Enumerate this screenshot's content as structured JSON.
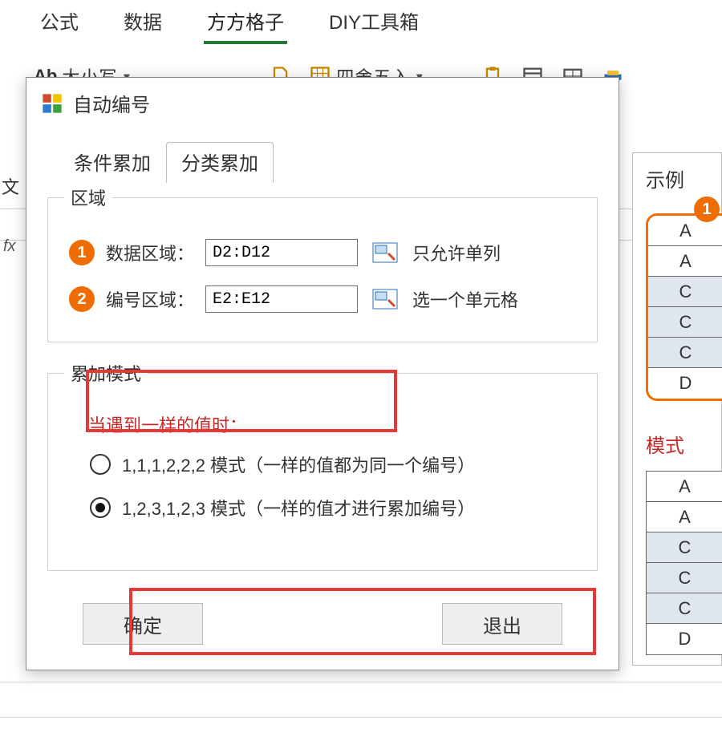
{
  "ribbon": {
    "tabs": [
      "",
      "公式",
      "数据",
      "方方格子",
      "DIY工具箱"
    ],
    "active_index": 3,
    "tool_case_label": "大小写",
    "tool_round_label": "四舍五入",
    "tool_ab_glyph": "Ab"
  },
  "leftbar": {
    "text_label": "文",
    "fx_label": "fx"
  },
  "dialog": {
    "title": "自动编号",
    "tabs": [
      "条件累加",
      "分类累加"
    ],
    "active_tab_index": 1,
    "region_group_title": "区域",
    "data_region_label": "数据区域：",
    "data_region_value": "D2:D12",
    "data_region_hint": "只允许单列",
    "number_region_label": "编号区域：",
    "number_region_value": "E2:E12",
    "number_region_hint": "选一个单元格",
    "badge1": "1",
    "badge2": "2",
    "mode_group_title": "累加模式",
    "mode_heading": "当遇到一样的值时：",
    "mode_option_a": "1,1,1,2,2,2 模式（一样的值都为同一个编号）",
    "mode_option_b": "1,2,3,1,2,3 模式（一样的值才进行累加编号）",
    "mode_selected_index": 1,
    "ok_label": "确定",
    "cancel_label": "退出"
  },
  "example": {
    "title": "示例",
    "badge": "1",
    "table1": [
      "A",
      "A",
      "C",
      "C",
      "C",
      "D"
    ],
    "gray_rows1": [
      2,
      3,
      4
    ],
    "mode_label": "模式",
    "table2": [
      "A",
      "A",
      "C",
      "C",
      "C",
      "D"
    ],
    "gray_rows2": [
      2,
      3,
      4
    ]
  }
}
